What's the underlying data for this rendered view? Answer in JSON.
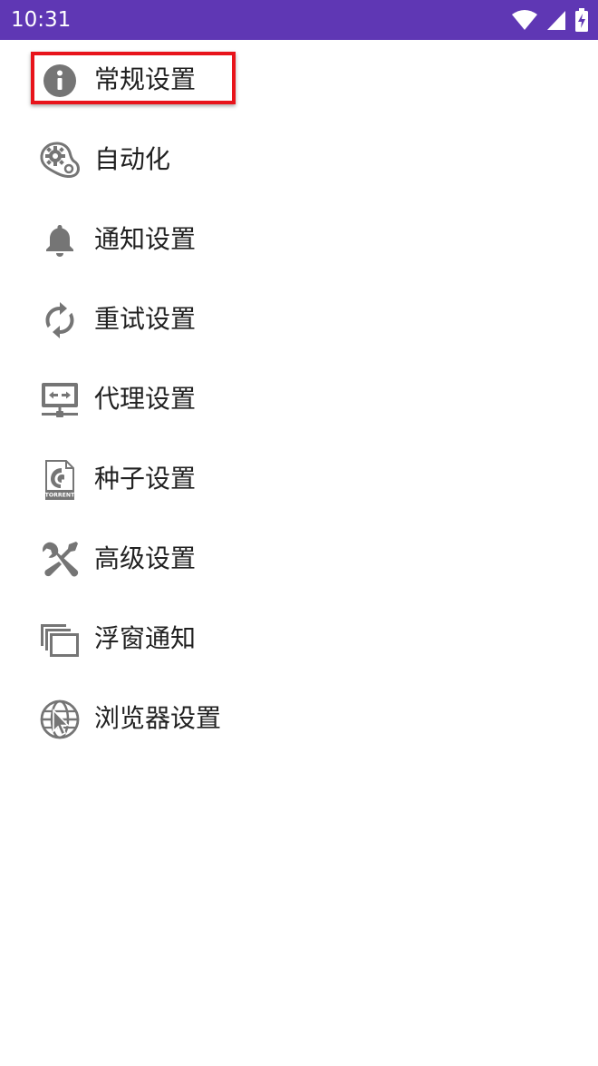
{
  "status_bar": {
    "time": "10:31",
    "icons": [
      "wifi-icon",
      "cellular-signal-icon",
      "battery-charging-icon"
    ],
    "background": "#5f37b4"
  },
  "menu": {
    "icon_color": "#757575",
    "highlight_color": "#e8141b",
    "items": [
      {
        "label": "常规设置",
        "icon": "info-icon",
        "highlighted": true
      },
      {
        "label": "自动化",
        "icon": "automation-gear-icon"
      },
      {
        "label": "通知设置",
        "icon": "bell-icon"
      },
      {
        "label": "重试设置",
        "icon": "retry-sync-icon"
      },
      {
        "label": "代理设置",
        "icon": "proxy-network-icon"
      },
      {
        "label": "种子设置",
        "icon": "torrent-file-icon"
      },
      {
        "label": "高级设置",
        "icon": "wrench-screwdriver-icon"
      },
      {
        "label": "浮窗通知",
        "icon": "floating-window-icon"
      },
      {
        "label": "浏览器设置",
        "icon": "globe-cursor-icon"
      }
    ],
    "torrent_icon_text": "TORRENT"
  }
}
